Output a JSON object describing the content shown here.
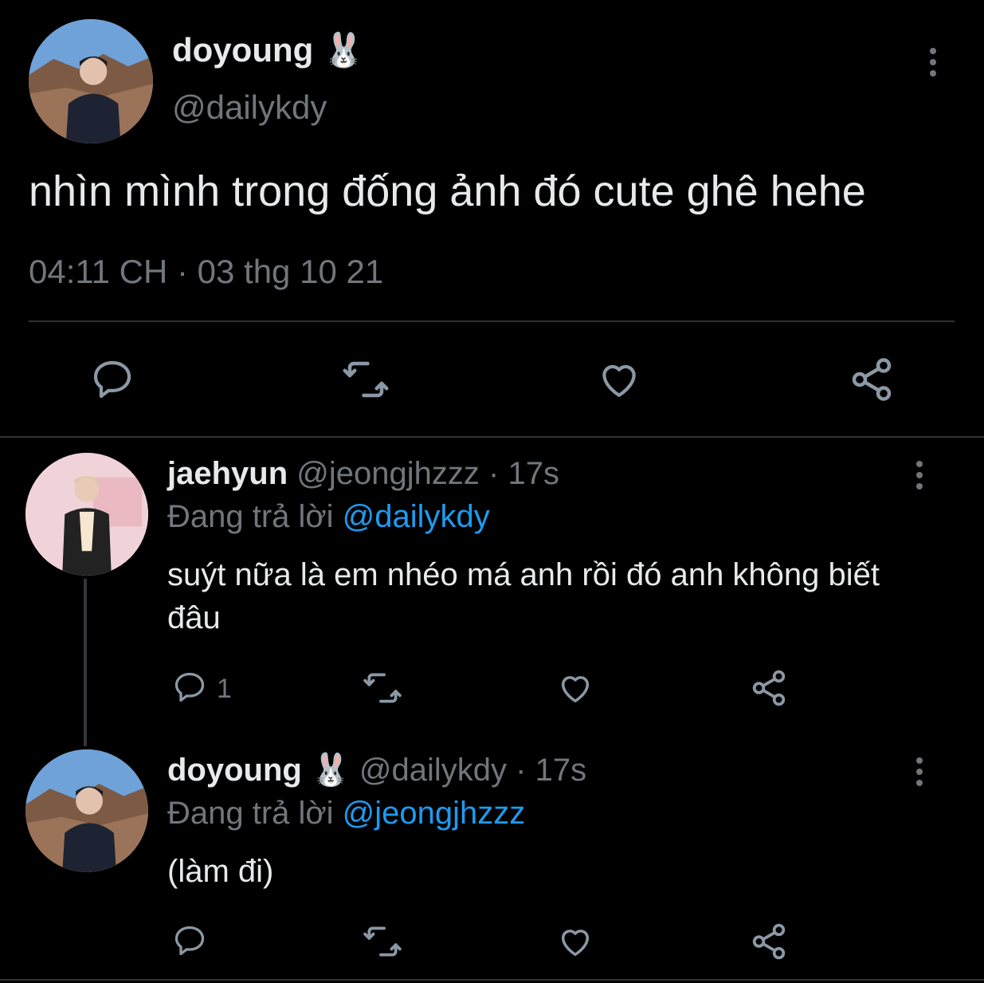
{
  "main_tweet": {
    "display_name": "doyoung",
    "emoji": "🐰",
    "handle": "@dailykdy",
    "text": "nhìn mình trong đống ảnh đó cute ghê hehe",
    "timestamp": "04:11 CH · 03 thg 10 21",
    "actions": [
      "reply-icon",
      "retweet-icon",
      "like-icon",
      "share-icon"
    ]
  },
  "replies": [
    {
      "display_name": "jaehyun",
      "handle": "@jeongjhzzz",
      "time": "· 17s",
      "replying_label": "Đang trả lời",
      "replying_to": "@dailykdy",
      "text": "suýt nữa là em nhéo má anh rồi đó anh không biết đâu",
      "reply_count": "1"
    },
    {
      "display_name": "doyoung",
      "emoji": "🐰",
      "handle": "@dailykdy",
      "time": "· 17s",
      "replying_label": "Đang trả lời",
      "replying_to": "@jeongjhzzz",
      "text": "(làm đi)",
      "reply_count": ""
    }
  ],
  "colors": {
    "background": "#000000",
    "text": "#e7e9ea",
    "muted": "#71767b",
    "link": "#1d9bf0",
    "divider": "#2f3336"
  }
}
